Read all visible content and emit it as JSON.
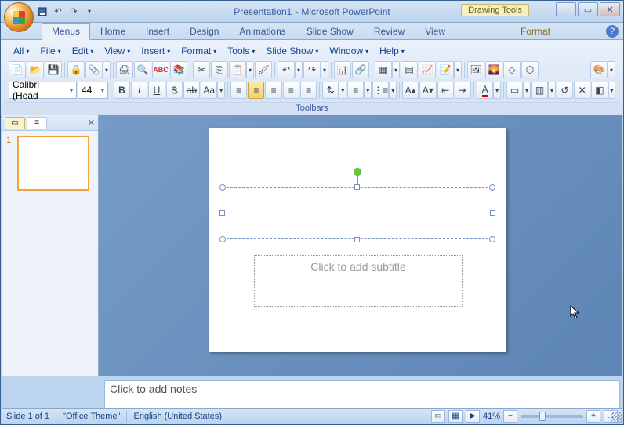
{
  "title": {
    "doc": "Presentation1",
    "sep": "-",
    "app": "Microsoft PowerPoint"
  },
  "contextual_tab": "Drawing Tools",
  "tabs": [
    "Menus",
    "Home",
    "Insert",
    "Design",
    "Animations",
    "Slide Show",
    "Review",
    "View"
  ],
  "format_tab": "Format",
  "menus": [
    {
      "label": "All"
    },
    {
      "label": "File"
    },
    {
      "label": "Edit"
    },
    {
      "label": "View"
    },
    {
      "label": "Insert"
    },
    {
      "label": "Format"
    },
    {
      "label": "Tools"
    },
    {
      "label": "Slide Show"
    },
    {
      "label": "Window"
    },
    {
      "label": "Help"
    }
  ],
  "font": {
    "name": "Calibri (Head",
    "size": "44"
  },
  "toolbars_label": "Toolbars",
  "thumb": {
    "num": "1"
  },
  "subtitle_placeholder": "Click to add subtitle",
  "notes_placeholder": "Click to add notes",
  "status": {
    "slide": "Slide 1 of 1",
    "theme": "\"Office Theme\"",
    "lang": "English (United States)",
    "zoom": "41%"
  }
}
